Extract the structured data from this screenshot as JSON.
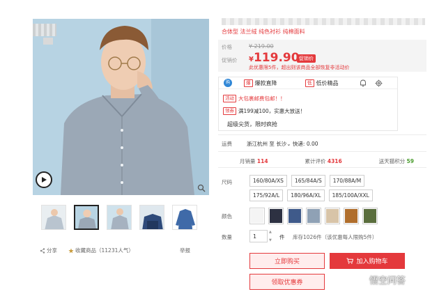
{
  "product": {
    "subtitle": "合体型 法兰绒 纯色衬衫 纯棉面料"
  },
  "price": {
    "label_orig": "价格",
    "orig": "¥ 219.00",
    "label_promo": "促销价",
    "symbol": "¥",
    "amount": "119.90",
    "tag": "促销价",
    "note": "此优惠限5件，超出则该商品全部恢复非活动价"
  },
  "promo": {
    "tabs": [
      {
        "icon_text": "购",
        "label": ""
      },
      {
        "icon_text": "爆",
        "label": "爆款直降"
      },
      {
        "icon_text": "低",
        "label": "低价精品"
      }
    ],
    "lines": [
      {
        "tag": "活动",
        "text": "大包裹邮费包邮！！"
      },
      {
        "tag": "领券",
        "text": "满199减100，实惠大放送！"
      }
    ],
    "hot": "超级尖货，限时疯抢"
  },
  "shipping": {
    "label": "运费",
    "text": "浙江杭州 至 长沙⌄ 快递: 0.00"
  },
  "stats": {
    "sales_label": "月销量",
    "sales": "114",
    "reviews_label": "累计评价",
    "reviews": "4316",
    "points_label": "送天猫积分",
    "points": "59"
  },
  "sizes": {
    "label": "尺码",
    "options": [
      "160/80A/XS",
      "165/84A/S",
      "170/88A/M",
      "175/92A/L",
      "180/96A/XL",
      "185/100A/XXL"
    ]
  },
  "colors": {
    "label": "颜色",
    "swatches": [
      "#f4f4f4",
      "#2d3142",
      "#3f5a8a",
      "#8fa1b5",
      "#d8c4a8",
      "#b06e2c",
      "#5a6e3d"
    ]
  },
  "quantity": {
    "label": "数量",
    "value": "1",
    "unit": "件",
    "stock": "库存1026件（该优惠每人限购5件）"
  },
  "buttons": {
    "buy": "立即购买",
    "cart": "加入购物车",
    "coupon": "领取优惠券"
  },
  "gallery": {
    "share": "分享",
    "favorite": "收藏商品（11231人气）",
    "report": "举报"
  },
  "watermark": "悟空问答",
  "accent_color": "#e4393c"
}
